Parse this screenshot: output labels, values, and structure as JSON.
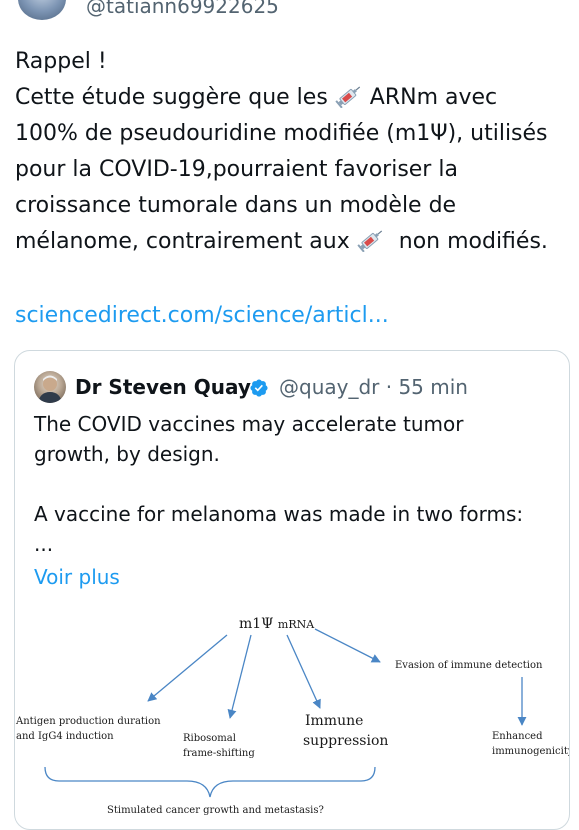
{
  "author": {
    "handle": "@tatiann69922625"
  },
  "tweet": {
    "lines": [
      "Rappel !",
      "Cette étude suggère que les",
      "ARNm avec",
      "100% de pseudouridine modifiée (m1Ψ), utilisés",
      "pour la COVID-19,pourraient favoriser la",
      "croissance tumorale dans un modèle de",
      "mélanome, contrairement aux",
      "non modifiés."
    ],
    "link": "sciencedirect.com/science/articl..."
  },
  "quote": {
    "name": "Dr Steven Quay",
    "handle_time": "@quay_dr · 55 min",
    "lines": [
      "The COVID vaccines may accelerate tumor",
      "growth, by design.",
      "",
      "A vaccine for melanoma was made in two forms:",
      "..."
    ],
    "more": "Voir plus",
    "diagram": {
      "top_symbol": "m1Ψ",
      "top_suffix": "mRNA",
      "evasion": "Evasion of immune detection",
      "antigen_1": "Antigen production duration",
      "antigen_2": "and IgG4 induction",
      "ribo_1": "Ribosomal",
      "ribo_2": "frame-shifting",
      "immune_1": "Immune",
      "immune_2": "suppression",
      "enhanced_1": "Enhanced",
      "enhanced_2": "immunogenicity",
      "bottom": "Stimulated cancer growth and metastasis?"
    }
  },
  "colors": {
    "link": "#1d9bf0",
    "arrow": "#4a86c5",
    "verified": "#1d9bf0"
  }
}
